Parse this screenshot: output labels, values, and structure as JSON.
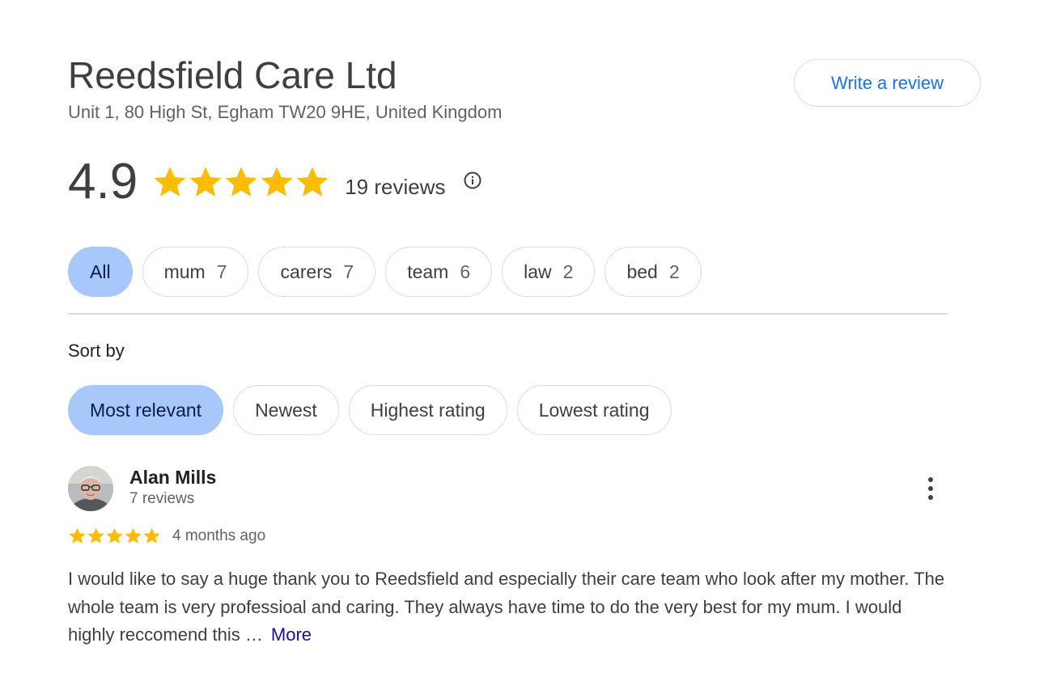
{
  "business": {
    "name": "Reedsfield Care Ltd",
    "address": "Unit 1, 80 High St, Egham TW20 9HE, United Kingdom"
  },
  "write_review_label": "Write a review",
  "summary": {
    "rating": "4.9",
    "stars": 5,
    "review_count": "19 reviews",
    "info_icon": "info-circle-icon"
  },
  "topics": [
    {
      "label": "All",
      "count": "",
      "selected": true
    },
    {
      "label": "mum",
      "count": "7",
      "selected": false
    },
    {
      "label": "carers",
      "count": "7",
      "selected": false
    },
    {
      "label": "team",
      "count": "6",
      "selected": false
    },
    {
      "label": "law",
      "count": "2",
      "selected": false
    },
    {
      "label": "bed",
      "count": "2",
      "selected": false
    }
  ],
  "sort": {
    "label": "Sort by",
    "options": [
      {
        "label": "Most relevant",
        "selected": true
      },
      {
        "label": "Newest",
        "selected": false
      },
      {
        "label": "Highest rating",
        "selected": false
      },
      {
        "label": "Lowest rating",
        "selected": false
      }
    ]
  },
  "review": {
    "author": "Alan Mills",
    "author_reviews": "7 reviews",
    "stars": 5,
    "time": "4 months ago",
    "text": "I would like to say a huge thank you to Reedsfield and especially their care team who look after my mother. The whole team is very professioal and caring. They always have time to do the very best for my mum. I would highly reccomend this …",
    "more_label": "More",
    "menu_icon": "more-vert-icon"
  },
  "colors": {
    "star": "#fbbc04",
    "selected_chip": "#a8c7fa",
    "link_blue": "#1a73e8",
    "more_link": "#1a0dab"
  }
}
